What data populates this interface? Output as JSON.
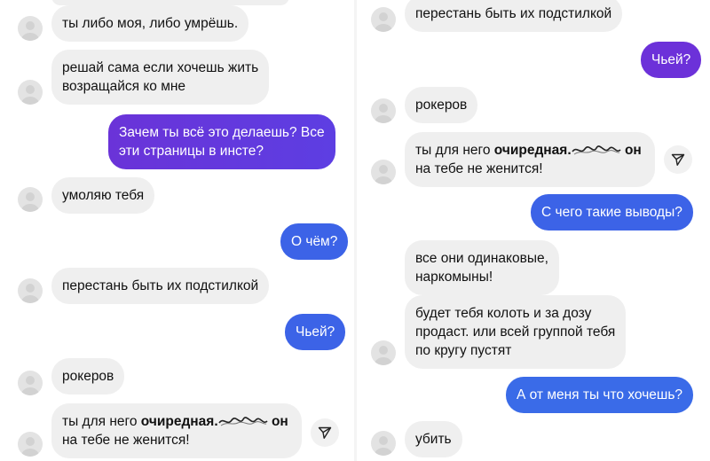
{
  "left": {
    "messages": [
      {
        "text": "ты либо моя, либо умрёшь."
      },
      {
        "line1": "решай сама если хочешь жить",
        "line2": "возращайся ко мне"
      },
      {
        "line1": "Зачем ты всё это делаешь? Все",
        "line2": "эти страницы в инсте?"
      },
      {
        "text": "умоляю тебя"
      },
      {
        "text": "О чём?"
      },
      {
        "text": "перестань быть их подстилкой"
      },
      {
        "text": "Чьей?"
      },
      {
        "text": "рокеров"
      },
      {
        "prefix": "ты для него ",
        "bold": "очиредная.",
        "bold_tail": " он",
        "line2": "на тебе не женится!"
      }
    ]
  },
  "right": {
    "messages": [
      {
        "text": "перестань быть их подстилкой"
      },
      {
        "text": "Чьей?"
      },
      {
        "text": "рокеров"
      },
      {
        "prefix": "ты для него ",
        "bold": "очиредная.",
        "bold_tail": " он",
        "line2": "на тебе не женится!"
      },
      {
        "text": "С чего такие выводы?"
      },
      {
        "line1": "все они одинаковые,",
        "line2": "наркомыны!"
      },
      {
        "line1": "будет тебя колоть и за дозу",
        "line2": "продаст. или всей группой тебя",
        "line3": "по кругу пустят"
      },
      {
        "text": "А от меня ты что хочешь?"
      },
      {
        "text": "убить"
      }
    ]
  },
  "colors": {
    "incoming_bubble": "#efefef",
    "outgoing_violet": "#6a33d8",
    "outgoing_blue": "#3c63e7",
    "avatar": "#e3e3e3"
  },
  "icons": [
    "avatar-placeholder",
    "share-icon"
  ]
}
